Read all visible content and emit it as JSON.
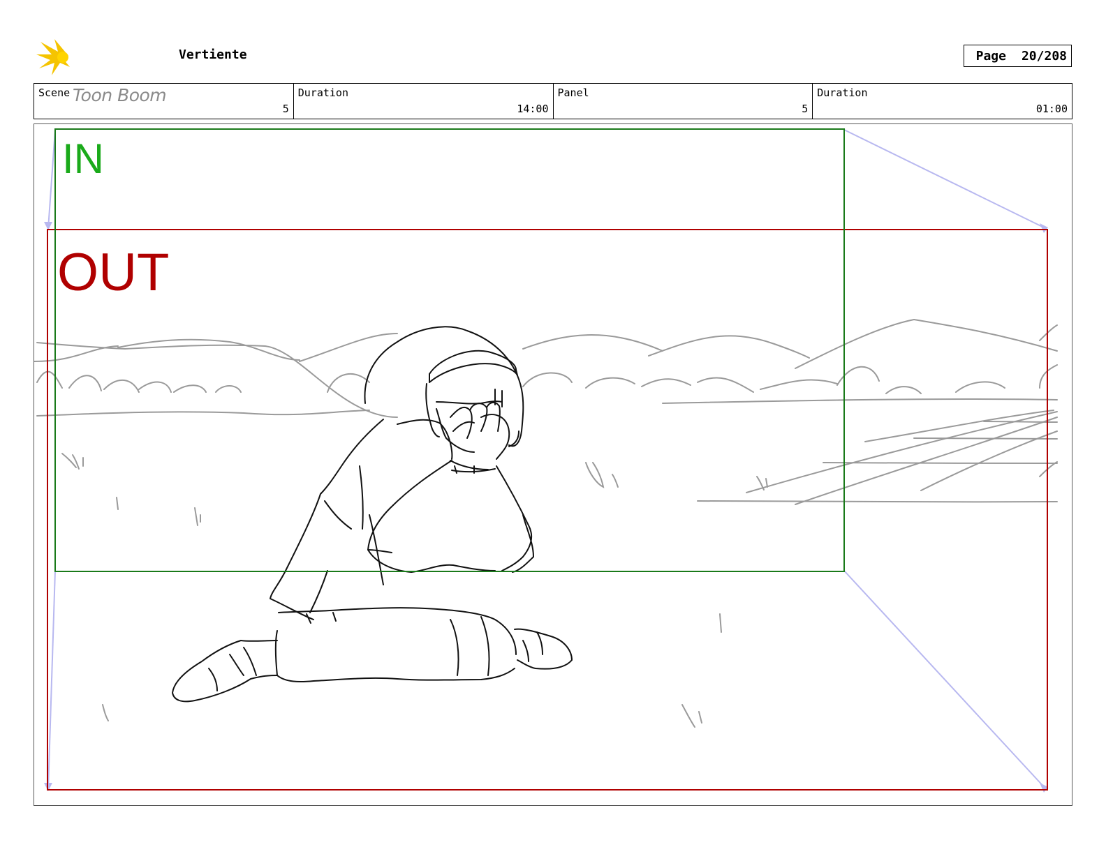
{
  "header": {
    "logo_text": "Toon Boom",
    "project_title": "Vertiente",
    "page_label": "Page",
    "page_value": "20/208"
  },
  "info": [
    {
      "label": "Scene",
      "value": "5"
    },
    {
      "label": "Duration",
      "value": "14:00"
    },
    {
      "label": "Panel",
      "value": "5"
    },
    {
      "label": "Duration",
      "value": "01:00"
    }
  ],
  "panel": {
    "in_label": "IN",
    "out_label": "OUT",
    "colors": {
      "in_frame": "#1a7a1a",
      "in_text": "#1aaa1a",
      "out_frame": "#b00000",
      "camera_move": "#b8b8f0",
      "sketch_line": "#111111",
      "background_line": "#9a9a9a"
    }
  }
}
